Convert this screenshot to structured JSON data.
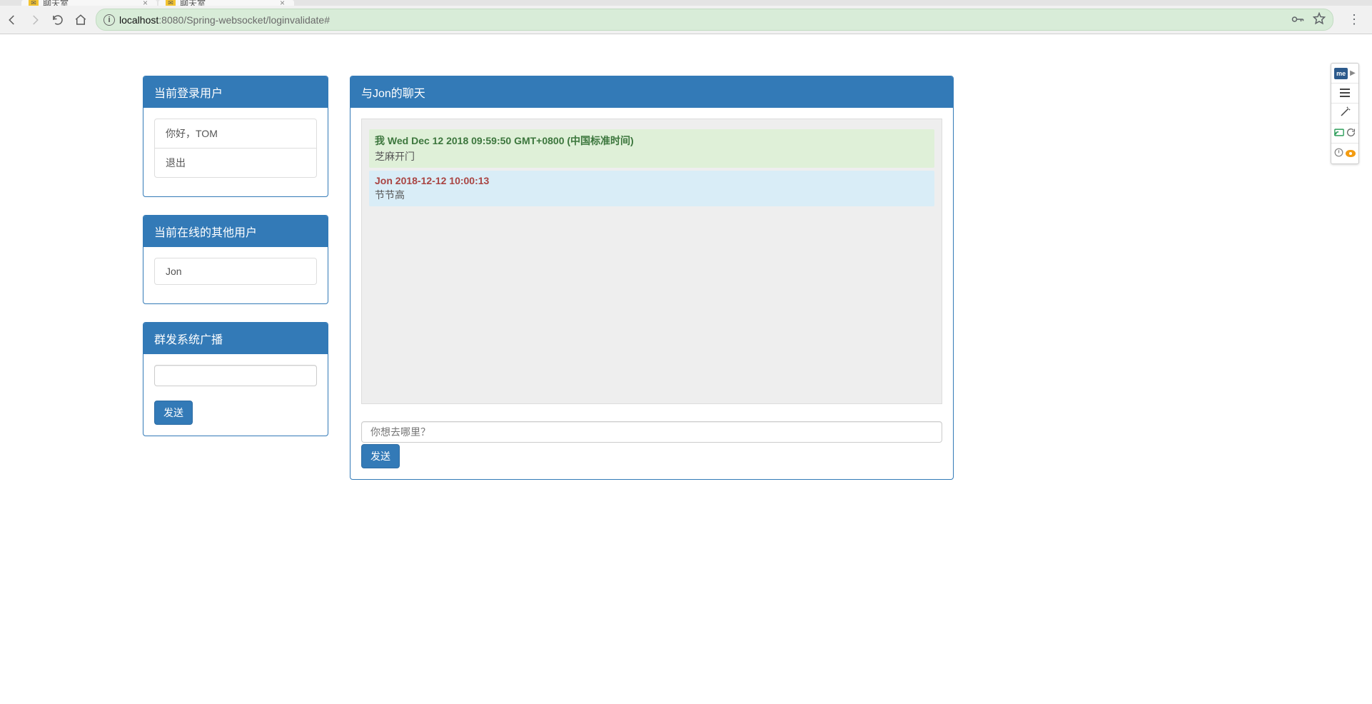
{
  "browser": {
    "tabs": [
      {
        "title": "聊天室"
      },
      {
        "title": "聊天室"
      }
    ],
    "url_host": "localhost",
    "url_port": ":8080",
    "url_path": "/Spring-websocket/loginvalidate#"
  },
  "sidebar": {
    "current_user_panel": {
      "title": "当前登录用户",
      "greeting": "你好，TOM",
      "logout": "退出"
    },
    "online_users_panel": {
      "title": "当前在线的其他用户",
      "users": [
        "Jon"
      ]
    },
    "broadcast_panel": {
      "title": "群发系统广播",
      "input_value": "",
      "send_label": "发送"
    }
  },
  "chat": {
    "title": "与Jon的聊天",
    "messages": [
      {
        "from": "me",
        "header": "我 Wed Dec 12 2018 09:59:50 GMT+0800 (中国标准时间)",
        "body": "芝麻开门"
      },
      {
        "from": "you",
        "header": "Jon 2018-12-12 10:00:13",
        "body": "节节高"
      }
    ],
    "input_placeholder": "你想去哪里？",
    "send_label": "发送"
  },
  "float_toolbar": {
    "badge": "me"
  }
}
